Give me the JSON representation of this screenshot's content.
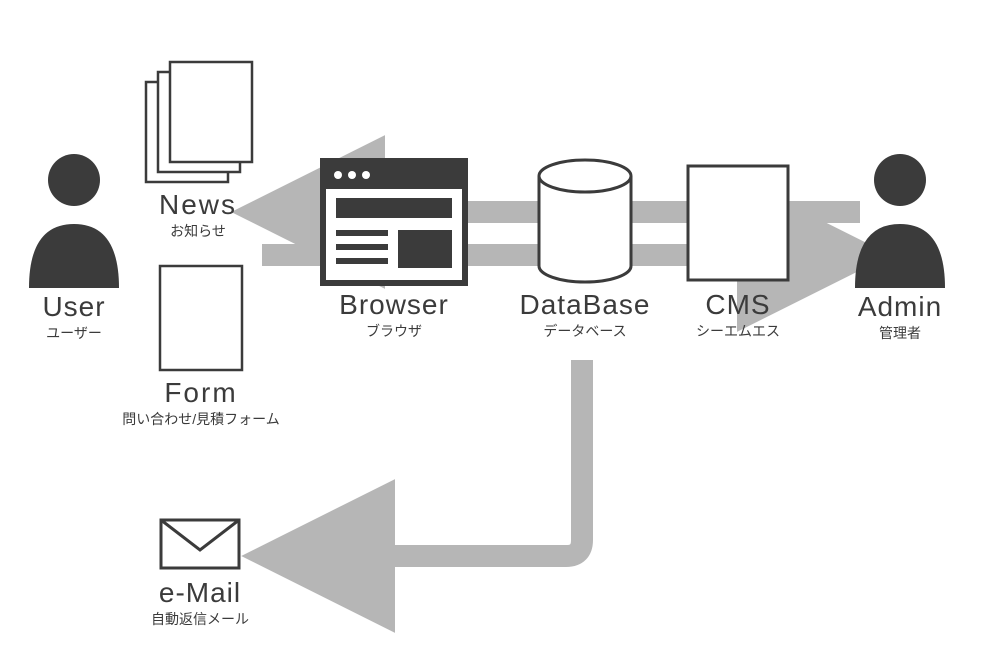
{
  "colors": {
    "ink": "#3b3b3b",
    "arrow": "#b6b6b6",
    "white": "#ffffff",
    "dark": "#3b3b3b"
  },
  "nodes": {
    "user": {
      "title": "User",
      "subtitle": "ユーザー"
    },
    "news": {
      "title": "News",
      "subtitle": "お知らせ"
    },
    "form": {
      "title": "Form",
      "subtitle": "問い合わせ/見積フォーム"
    },
    "email": {
      "title": "e-Mail",
      "subtitle": "自動返信メール"
    },
    "browser": {
      "title": "Browser",
      "subtitle": "ブラウザ"
    },
    "database": {
      "title": "DataBase",
      "subtitle": "データベース"
    },
    "cms": {
      "title": "CMS",
      "subtitle": "シーエムエス"
    },
    "admin": {
      "title": "Admin",
      "subtitle": "管理者"
    }
  }
}
